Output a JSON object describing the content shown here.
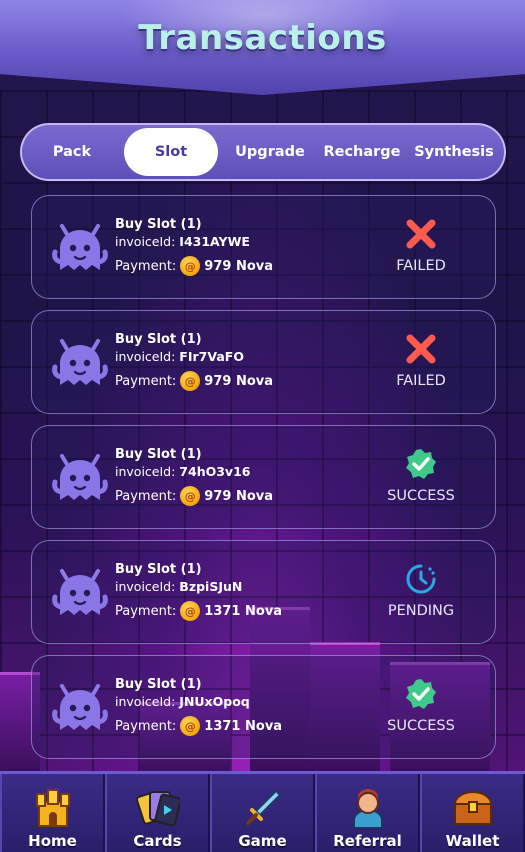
{
  "header": {
    "title": "Transactions"
  },
  "tabs": [
    {
      "label": "Pack"
    },
    {
      "label": "Slot",
      "active": true
    },
    {
      "label": "Upgrade"
    },
    {
      "label": "Recharge"
    },
    {
      "label": "Synthesis"
    }
  ],
  "transactions": [
    {
      "title": "Buy Slot (1)",
      "invoice_label": "invoiceId:",
      "invoice_id": "I431AYWE",
      "payment_label": "Payment:",
      "amount": "979 Nova",
      "status": "FAILED",
      "status_icon": "failed-x-icon"
    },
    {
      "title": "Buy Slot (1)",
      "invoice_label": "invoiceId:",
      "invoice_id": "FIr7VaFO",
      "payment_label": "Payment:",
      "amount": "979 Nova",
      "status": "FAILED",
      "status_icon": "failed-x-icon"
    },
    {
      "title": "Buy Slot (1)",
      "invoice_label": "invoiceId:",
      "invoice_id": "74hO3v16",
      "payment_label": "Payment:",
      "amount": "979 Nova",
      "status": "SUCCESS",
      "status_icon": "success-badge-icon"
    },
    {
      "title": "Buy Slot (1)",
      "invoice_label": "invoiceId:",
      "invoice_id": "BzpiSJuN",
      "payment_label": "Payment:",
      "amount": "1371 Nova",
      "status": "PENDING",
      "status_icon": "pending-clock-icon"
    },
    {
      "title": "Buy Slot (1)",
      "invoice_label": "invoiceId:",
      "invoice_id": "JNUxOpoq",
      "payment_label": "Payment:",
      "amount": "1371 Nova",
      "status": "SUCCESS",
      "status_icon": "success-badge-icon"
    }
  ],
  "nav": [
    {
      "label": "Home",
      "icon": "castle-icon"
    },
    {
      "label": "Cards",
      "icon": "cards-icon"
    },
    {
      "label": "Game",
      "icon": "sword-icon"
    },
    {
      "label": "Referral",
      "icon": "person-icon"
    },
    {
      "label": "Wallet",
      "icon": "treasure-chest-icon"
    }
  ],
  "colors": {
    "failed": "#ff5a4e",
    "success": "#3fc98a",
    "pending": "#2aa8e8",
    "accent": "#6a5cc9"
  }
}
